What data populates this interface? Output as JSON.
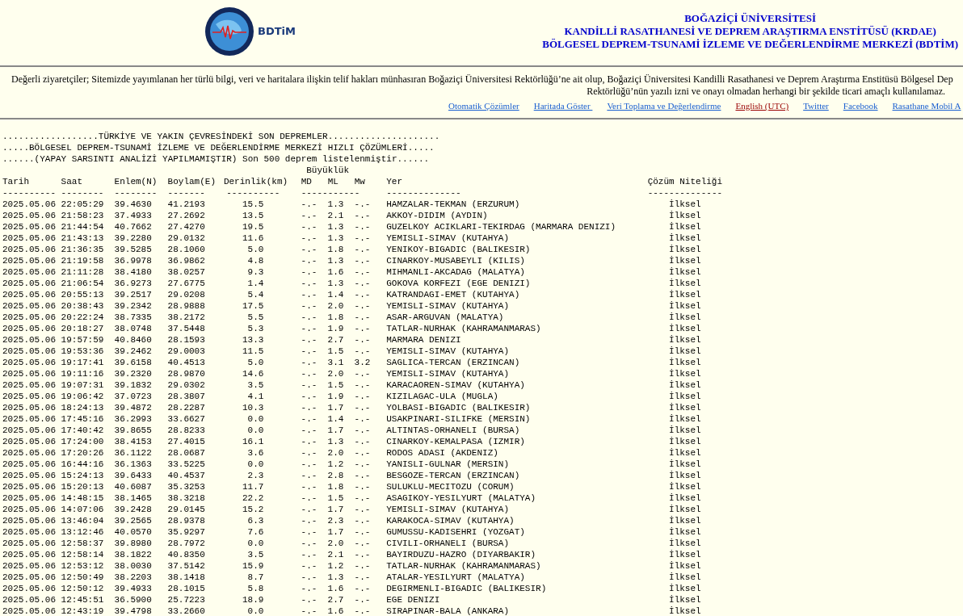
{
  "header": {
    "logo_text": "BDTiM",
    "titles": [
      "BOĞAZİÇİ ÜNİVERSİTESİ",
      "KANDİLLİ RASATHANESİ VE DEPREM ARAŞTIRMA ENSTİTÜSÜ (KRDAE)",
      "BÖLGESEL DEPREM-TSUNAMİ İZLEME VE DEĞERLENDİRME MERKEZİ (BDTİM)"
    ]
  },
  "notice": [
    "Değerli ziyaretçiler; Sitemizde yayımlanan her türlü bilgi, veri ve haritalara ilişkin telif hakları münhasıran Boğaziçi Üniversitesi Rektörlüğü’ne ait olup, Boğaziçi Üniversitesi Kandilli Rasathanesi ve Deprem Araştırma Enstitüsü Bölgesel Dep",
    "Rektörlüğü’nün yazılı izni ve onayı olmadan herhangi bir şekilde ticari amaçlı kullanılamaz."
  ],
  "links": [
    {
      "label": "Otomatik Çözümler",
      "kind": "normal"
    },
    {
      "label": "Haritada Göster ",
      "kind": "normal"
    },
    {
      "label": "Veri Toplama ve Değerlendirme",
      "kind": "normal"
    },
    {
      "label": "English (UTC)",
      "kind": "language"
    },
    {
      "label": "Twitter",
      "kind": "normal"
    },
    {
      "label": "Facebook",
      "kind": "normal"
    },
    {
      "label": "Rasathane Mobil A",
      "kind": "normal"
    }
  ],
  "listing": {
    "title_lines": [
      "..................TÜRKİYE VE YAKIN ÇEVRESİNDEKİ SON DEPREMLER.....................",
      ".....BÖLGESEL DEPREM-TSUNAMİ İZLEME VE DEĞERLENDİRME MERKEZİ HIZLI ÇÖZÜMLERİ.....",
      "......(YAPAY SARSINTI ANALİZİ YAPILMAMIŞTIR) Son 500 deprem listelenmiştir......"
    ],
    "group_heading": "Büyüklük",
    "columns": [
      "Tarih",
      "Saat",
      "Enlem(N)",
      "Boylam(E)",
      "Derinlik(km)",
      "MD",
      "ML",
      "Mw",
      "Yer",
      "Çözüm Niteliği"
    ],
    "dashes": [
      "----------",
      "--------",
      "--------",
      "-------",
      "----------",
      "-----------",
      "--------------",
      "--------------"
    ],
    "rows": [
      [
        "2025.05.06",
        "22:05:29",
        "39.4630",
        "41.2193",
        "15.5",
        "-.-",
        "1.3",
        "-.-",
        "HAMZALAR-TEKMAN (ERZURUM)",
        "İlksel"
      ],
      [
        "2025.05.06",
        "21:58:23",
        "37.4933",
        "27.2692",
        "13.5",
        "-.-",
        "2.1",
        "-.-",
        "AKKOY-DIDIM (AYDIN)",
        "İlksel"
      ],
      [
        "2025.05.06",
        "21:44:54",
        "40.7662",
        "27.4270",
        "19.5",
        "-.-",
        "1.3",
        "-.-",
        "GUZELKOY ACIKLARI-TEKIRDAG (MARMARA DENIZI)",
        "İlksel"
      ],
      [
        "2025.05.06",
        "21:43:13",
        "39.2280",
        "29.0132",
        "11.6",
        "-.-",
        "1.3",
        "-.-",
        "YEMISLI-SIMAV (KUTAHYA)",
        "İlksel"
      ],
      [
        "2025.05.06",
        "21:36:35",
        "39.5285",
        "28.1060",
        "5.0",
        "-.-",
        "1.8",
        "-.-",
        "YENIKOY-BIGADIC (BALIKESIR)",
        "İlksel"
      ],
      [
        "2025.05.06",
        "21:19:58",
        "36.9978",
        "36.9862",
        "4.8",
        "-.-",
        "1.3",
        "-.-",
        "CINARKOY-MUSABEYLI (KILIS)",
        "İlksel"
      ],
      [
        "2025.05.06",
        "21:11:28",
        "38.4180",
        "38.0257",
        "9.3",
        "-.-",
        "1.6",
        "-.-",
        "MIHMANLI-AKCADAG (MALATYA)",
        "İlksel"
      ],
      [
        "2025.05.06",
        "21:06:54",
        "36.9273",
        "27.6775",
        "1.4",
        "-.-",
        "1.3",
        "-.-",
        "GOKOVA KORFEZI (EGE DENIZI)",
        "İlksel"
      ],
      [
        "2025.05.06",
        "20:55:13",
        "39.2517",
        "29.0208",
        "5.4",
        "-.-",
        "1.4",
        "-.-",
        "KATRANDAGI-EMET (KUTAHYA)",
        "İlksel"
      ],
      [
        "2025.05.06",
        "20:38:43",
        "39.2342",
        "28.9888",
        "17.5",
        "-.-",
        "2.0",
        "-.-",
        "YEMISLI-SIMAV (KUTAHYA)",
        "İlksel"
      ],
      [
        "2025.05.06",
        "20:22:24",
        "38.7335",
        "38.2172",
        "5.5",
        "-.-",
        "1.8",
        "-.-",
        "ASAR-ARGUVAN (MALATYA)",
        "İlksel"
      ],
      [
        "2025.05.06",
        "20:18:27",
        "38.0748",
        "37.5448",
        "5.3",
        "-.-",
        "1.9",
        "-.-",
        "TATLAR-NURHAK (KAHRAMANMARAS)",
        "İlksel"
      ],
      [
        "2025.05.06",
        "19:57:59",
        "40.8460",
        "28.1593",
        "13.3",
        "-.-",
        "2.7",
        "-.-",
        "MARMARA DENIZI",
        "İlksel"
      ],
      [
        "2025.05.06",
        "19:53:36",
        "39.2462",
        "29.0003",
        "11.5",
        "-.-",
        "1.5",
        "-.-",
        "YEMISLI-SIMAV (KUTAHYA)",
        "İlksel"
      ],
      [
        "2025.05.06",
        "19:17:41",
        "39.6158",
        "40.4513",
        "5.0",
        "-.-",
        "3.1",
        "3.2",
        "SAGLICA-TERCAN (ERZINCAN)",
        "İlksel"
      ],
      [
        "2025.05.06",
        "19:11:16",
        "39.2320",
        "28.9870",
        "14.6",
        "-.-",
        "2.0",
        "-.-",
        "YEMISLI-SIMAV (KUTAHYA)",
        "İlksel"
      ],
      [
        "2025.05.06",
        "19:07:31",
        "39.1832",
        "29.0302",
        "3.5",
        "-.-",
        "1.5",
        "-.-",
        "KARACAOREN-SIMAV (KUTAHYA)",
        "İlksel"
      ],
      [
        "2025.05.06",
        "19:06:42",
        "37.0723",
        "28.3807",
        "4.1",
        "-.-",
        "1.9",
        "-.-",
        "KIZILAGAC-ULA (MUGLA)",
        "İlksel"
      ],
      [
        "2025.05.06",
        "18:24:13",
        "39.4872",
        "28.2287",
        "10.3",
        "-.-",
        "1.7",
        "-.-",
        "YOLBASI-BIGADIC (BALIKESIR)",
        "İlksel"
      ],
      [
        "2025.05.06",
        "17:45:16",
        "36.2993",
        "33.6627",
        "0.0",
        "-.-",
        "1.4",
        "-.-",
        "USAKPINARI-SILIFKE (MERSIN)",
        "İlksel"
      ],
      [
        "2025.05.06",
        "17:40:42",
        "39.8655",
        "28.8233",
        "0.0",
        "-.-",
        "1.7",
        "-.-",
        "ALTINTAS-ORHANELI (BURSA)",
        "İlksel"
      ],
      [
        "2025.05.06",
        "17:24:00",
        "38.4153",
        "27.4015",
        "16.1",
        "-.-",
        "1.3",
        "-.-",
        "CINARKOY-KEMALPASA (IZMIR)",
        "İlksel"
      ],
      [
        "2025.05.06",
        "17:20:26",
        "36.1122",
        "28.0687",
        "3.6",
        "-.-",
        "2.0",
        "-.-",
        "RODOS ADASI (AKDENIZ)",
        "İlksel"
      ],
      [
        "2025.05.06",
        "16:44:16",
        "36.1363",
        "33.5225",
        "0.0",
        "-.-",
        "1.2",
        "-.-",
        "YANISLI-GULNAR (MERSIN)",
        "İlksel"
      ],
      [
        "2025.05.06",
        "15:24:13",
        "39.6433",
        "40.4537",
        "2.3",
        "-.-",
        "2.8",
        "-.-",
        "BESGOZE-TERCAN (ERZINCAN)",
        "İlksel"
      ],
      [
        "2025.05.06",
        "15:20:13",
        "40.6087",
        "35.3253",
        "11.7",
        "-.-",
        "1.8",
        "-.-",
        "SULUKLU-MECITOZU (CORUM)",
        "İlksel"
      ],
      [
        "2025.05.06",
        "14:48:15",
        "38.1465",
        "38.3218",
        "22.2",
        "-.-",
        "1.5",
        "-.-",
        "ASAGIKOY-YESILYURT (MALATYA)",
        "İlksel"
      ],
      [
        "2025.05.06",
        "14:07:06",
        "39.2428",
        "29.0145",
        "15.2",
        "-.-",
        "1.7",
        "-.-",
        "YEMISLI-SIMAV (KUTAHYA)",
        "İlksel"
      ],
      [
        "2025.05.06",
        "13:46:04",
        "39.2565",
        "28.9378",
        "6.3",
        "-.-",
        "2.3",
        "-.-",
        "KARAKOCA-SIMAV (KUTAHYA)",
        "İlksel"
      ],
      [
        "2025.05.06",
        "13:12:46",
        "40.0570",
        "35.9297",
        "7.6",
        "-.-",
        "1.7",
        "-.-",
        "GUMUSSU-KADISEHRI (YOZGAT)",
        "İlksel"
      ],
      [
        "2025.05.06",
        "12:58:37",
        "39.8980",
        "28.7972",
        "0.0",
        "-.-",
        "2.0",
        "-.-",
        "CIVILI-ORHANELI (BURSA)",
        "İlksel"
      ],
      [
        "2025.05.06",
        "12:58:14",
        "38.1822",
        "40.8350",
        "3.5",
        "-.-",
        "2.1",
        "-.-",
        "BAYIRDUZU-HAZRO (DIYARBAKIR)",
        "İlksel"
      ],
      [
        "2025.05.06",
        "12:53:12",
        "38.0030",
        "37.5142",
        "15.9",
        "-.-",
        "1.2",
        "-.-",
        "TATLAR-NURHAK (KAHRAMANMARAS)",
        "İlksel"
      ],
      [
        "2025.05.06",
        "12:50:49",
        "38.2203",
        "38.1418",
        "8.7",
        "-.-",
        "1.3",
        "-.-",
        "ATALAR-YESILYURT (MALATYA)",
        "İlksel"
      ],
      [
        "2025.05.06",
        "12:50:12",
        "39.4933",
        "28.1015",
        "5.8",
        "-.-",
        "1.6",
        "-.-",
        "DEGIRMENLI-BIGADIC (BALIKESIR)",
        "İlksel"
      ],
      [
        "2025.05.06",
        "12:45:51",
        "36.5900",
        "25.7223",
        "18.9",
        "-.-",
        "2.7",
        "-.-",
        "EGE DENIZI",
        "İlksel"
      ],
      [
        "2025.05.06",
        "12:43:19",
        "39.4798",
        "33.2660",
        "0.0",
        "-.-",
        "1.6",
        "-.-",
        "SIRAPINAR-BALA (ANKARA)",
        "İlksel"
      ]
    ]
  }
}
